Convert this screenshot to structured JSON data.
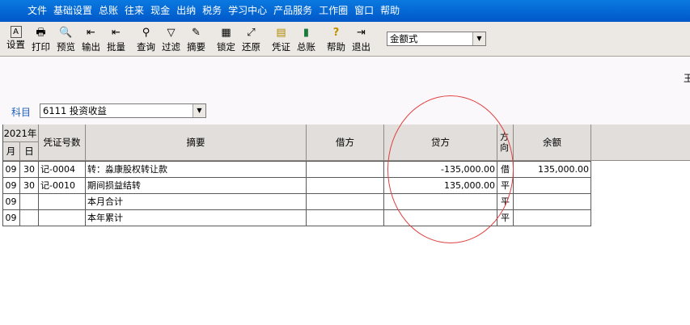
{
  "menu": [
    "文件",
    "基础设置",
    "总账",
    "往来",
    "现金",
    "出纳",
    "税务",
    "学习中心",
    "产品服务",
    "工作圈",
    "窗口",
    "帮助"
  ],
  "toolbar": {
    "buttons": [
      {
        "label": "设置",
        "icon": "settings-icon",
        "glyph": "A"
      },
      {
        "label": "打印",
        "icon": "printer-icon",
        "glyph": "🖶"
      },
      {
        "label": "预览",
        "icon": "preview-icon",
        "glyph": "🔍"
      },
      {
        "label": "输出",
        "icon": "export-icon",
        "glyph": "⇤"
      },
      {
        "label": "批量",
        "icon": "batch-icon",
        "glyph": "⇤"
      },
      {
        "label": "查询",
        "icon": "binoculars-icon",
        "glyph": "⚲"
      },
      {
        "label": "过滤",
        "icon": "filter-icon",
        "glyph": "▽"
      },
      {
        "label": "摘要",
        "icon": "summary-icon",
        "glyph": "✎"
      },
      {
        "label": "锁定",
        "icon": "lock-icon",
        "glyph": "▦"
      },
      {
        "label": "还原",
        "icon": "restore-icon",
        "glyph": "⤢"
      },
      {
        "label": "凭证",
        "icon": "voucher-icon",
        "glyph": "▤"
      },
      {
        "label": "总账",
        "icon": "ledger-icon",
        "glyph": "▮"
      },
      {
        "label": "帮助",
        "icon": "help-icon",
        "glyph": "?"
      },
      {
        "label": "退出",
        "icon": "exit-icon",
        "glyph": "⇥"
      }
    ],
    "format_select": "金额式"
  },
  "edge_char": "王",
  "subject": {
    "label": "科目",
    "value": "6111 投资收益"
  },
  "table": {
    "year_header": "2021年",
    "headers": {
      "month": "月",
      "day": "日",
      "voucher": "凭证号数",
      "summary": "摘要",
      "debit": "借方",
      "credit": "贷方",
      "direction": "方向",
      "balance": "余额"
    },
    "rows": [
      {
        "month": "09",
        "day": "30",
        "voucher": "记-0004",
        "summary": "转：淼康股权转让款",
        "debit": "",
        "credit": "-135,000.00",
        "direction": "借",
        "balance": "135,000.00"
      },
      {
        "month": "09",
        "day": "30",
        "voucher": "记-0010",
        "summary": "期间损益结转",
        "debit": "",
        "credit": "135,000.00",
        "direction": "平",
        "balance": ""
      },
      {
        "month": "09",
        "day": "",
        "voucher": "",
        "summary": "本月合计",
        "debit": "",
        "credit": "",
        "direction": "平",
        "balance": ""
      },
      {
        "month": "09",
        "day": "",
        "voucher": "",
        "summary": "本年累计",
        "debit": "",
        "credit": "",
        "direction": "平",
        "balance": ""
      }
    ]
  },
  "colors": {
    "menubar": "#0a6ad8",
    "annotation": "#e04040"
  }
}
